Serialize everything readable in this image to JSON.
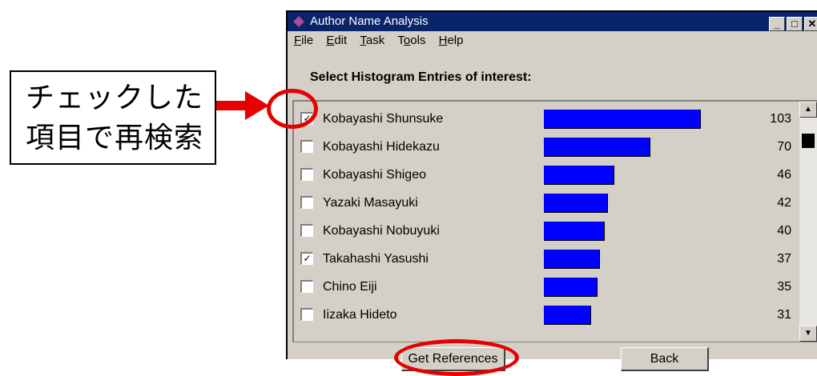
{
  "annotation": {
    "line1": "チェックした",
    "line2": "項目で再検索",
    "accent_color": "#e60000"
  },
  "window": {
    "title": "Author Name Analysis",
    "controls": [
      "minimize-icon",
      "maximize-icon",
      "close-icon"
    ]
  },
  "menu": [
    {
      "label": "File",
      "mnemonic": "F"
    },
    {
      "label": "Edit",
      "mnemonic": "E"
    },
    {
      "label": "Task",
      "mnemonic": "T"
    },
    {
      "label": "Tools",
      "mnemonic": "o"
    },
    {
      "label": "Help",
      "mnemonic": "H"
    }
  ],
  "heading": "Select Histogram Entries of interest:",
  "histogram": {
    "bar_color": "#0000ff",
    "max_value": 103,
    "entries": [
      {
        "name": "Kobayashi Shunsuke",
        "count": 103,
        "checked": true
      },
      {
        "name": "Kobayashi Hidekazu",
        "count": 70,
        "checked": false
      },
      {
        "name": "Kobayashi Shigeo",
        "count": 46,
        "checked": false
      },
      {
        "name": "Yazaki Masayuki",
        "count": 42,
        "checked": false
      },
      {
        "name": "Kobayashi Nobuyuki",
        "count": 40,
        "checked": false
      },
      {
        "name": "Takahashi Yasushi",
        "count": 37,
        "checked": true
      },
      {
        "name": "Chino Eiji",
        "count": 35,
        "checked": false
      },
      {
        "name": "Iizaka Hideto",
        "count": 31,
        "checked": false
      }
    ]
  },
  "buttons": {
    "get_references": "Get References",
    "back": "Back"
  }
}
